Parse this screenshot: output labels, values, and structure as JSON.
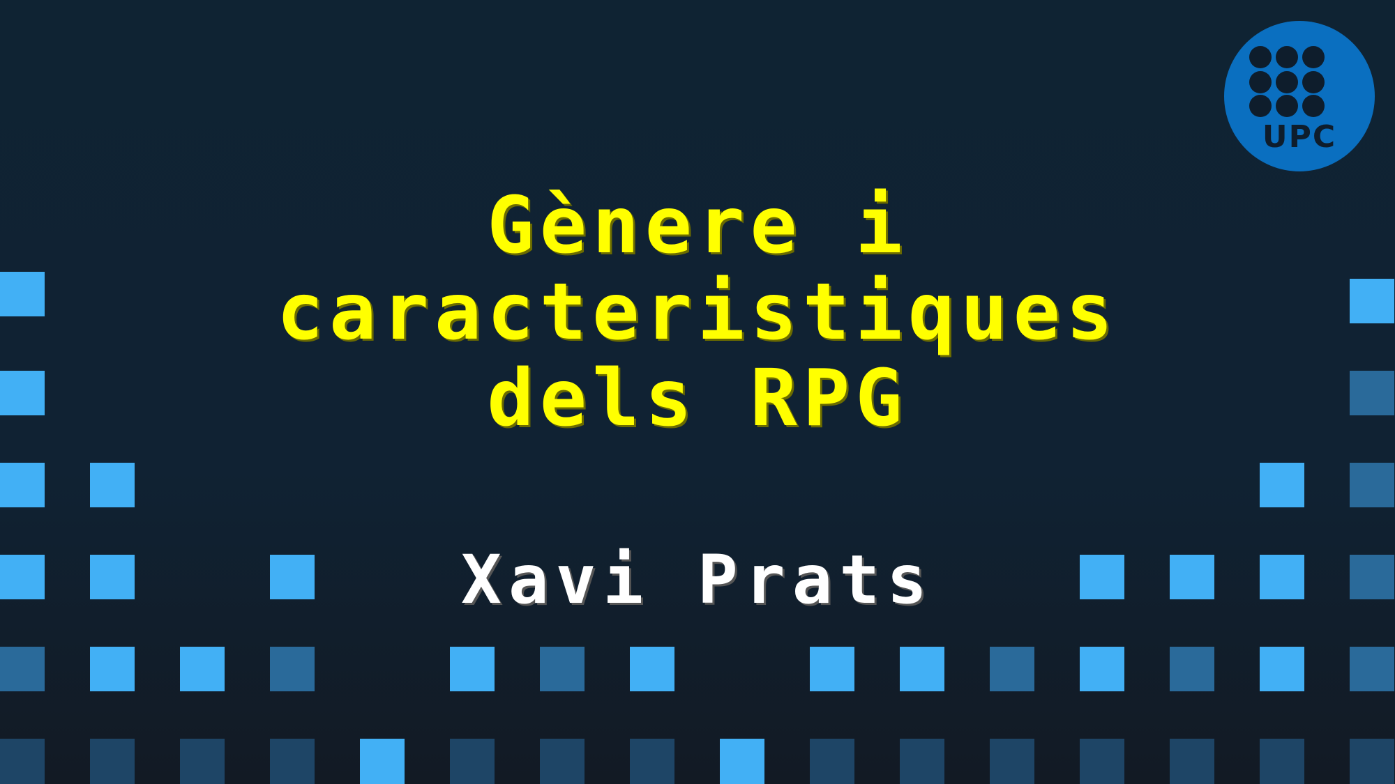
{
  "slide": {
    "title_lines": [
      "Gènere i",
      "caracteristiques",
      "dels RPG"
    ],
    "author": "Xavi Prats"
  },
  "logo": {
    "text": "UPC",
    "color": "#0a6fc0"
  },
  "colors": {
    "title": "#ffff00",
    "author": "#ffffff",
    "square_bright": "#42b0f5",
    "square_mid": "#2a6a9a",
    "square_dark": "#1e4566"
  }
}
